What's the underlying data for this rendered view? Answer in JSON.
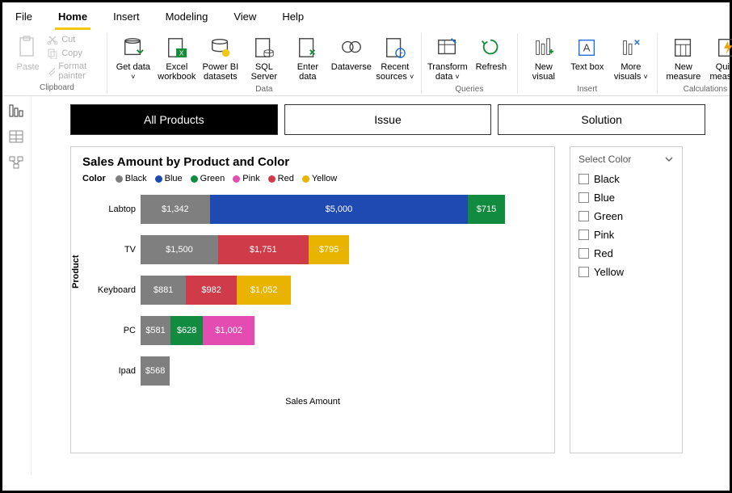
{
  "menu": {
    "items": [
      "File",
      "Home",
      "Insert",
      "Modeling",
      "View",
      "Help"
    ],
    "active": "Home"
  },
  "ribbon": {
    "clipboard": {
      "paste": "Paste",
      "cut": "Cut",
      "copy": "Copy",
      "format": "Format painter",
      "label": "Clipboard"
    },
    "data": {
      "get": "Get data",
      "excel": "Excel workbook",
      "pbi": "Power BI datasets",
      "sql": "SQL Server",
      "enter": "Enter data",
      "dataverse": "Dataverse",
      "recent": "Recent sources",
      "label": "Data"
    },
    "queries": {
      "transform": "Transform data",
      "refresh": "Refresh",
      "label": "Queries"
    },
    "insert": {
      "newvisual": "New visual",
      "textbox": "Text box",
      "more": "More visuals",
      "label": "Insert"
    },
    "calc": {
      "newmeasure": "New measure",
      "quick": "Quick measure",
      "label": "Calculations"
    }
  },
  "tabs": {
    "items": [
      "All Products",
      "Issue",
      "Solution"
    ],
    "active": "All Products"
  },
  "chart_data": {
    "type": "bar",
    "title": "Sales Amount by Product and Color",
    "legend_title": "Color",
    "ylabel": "Product",
    "xlabel": "Sales Amount",
    "max": 7200,
    "colors": {
      "Black": "#7f7f7f",
      "Blue": "#1f4ab1",
      "Green": "#108b3f",
      "Pink": "#e34cb1",
      "Red": "#cf3b49",
      "Yellow": "#e8b400"
    },
    "categories": [
      "Labtop",
      "TV",
      "Keyboard",
      "PC",
      "Ipad"
    ],
    "series": [
      {
        "name": "Black",
        "values": {
          "Labtop": 1342,
          "TV": 1500,
          "Keyboard": 881,
          "PC": 581,
          "Ipad": 568
        }
      },
      {
        "name": "Blue",
        "values": {
          "Labtop": 5000
        }
      },
      {
        "name": "Green",
        "values": {
          "Labtop": 715,
          "PC": 628
        }
      },
      {
        "name": "Pink",
        "values": {
          "PC": 1002
        }
      },
      {
        "name": "Red",
        "values": {
          "TV": 1751,
          "Keyboard": 982
        }
      },
      {
        "name": "Yellow",
        "values": {
          "TV": 795,
          "Keyboard": 1052
        }
      }
    ]
  },
  "slicer": {
    "title": "Select Color",
    "items": [
      "Black",
      "Blue",
      "Green",
      "Pink",
      "Red",
      "Yellow"
    ]
  }
}
